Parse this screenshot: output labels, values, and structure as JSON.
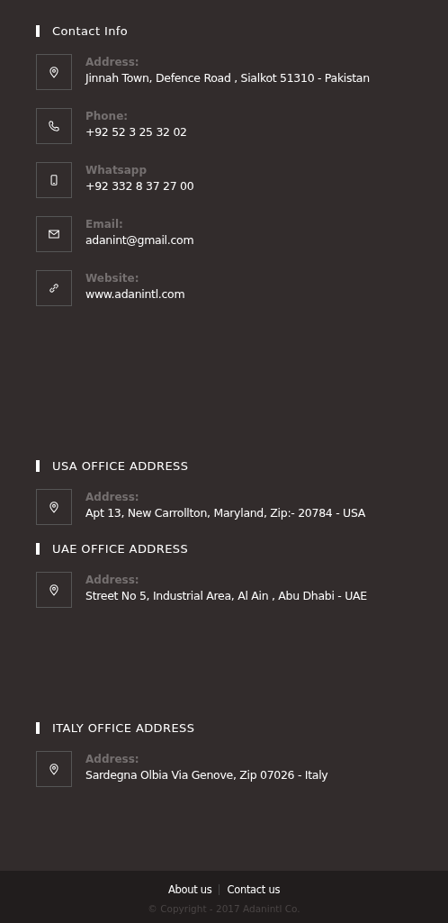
{
  "sections": [
    {
      "title": "Contact Info",
      "items": [
        {
          "kind": "address",
          "label": "Address:",
          "value": "Jinnah Town, Defence Road , Sialkot 51310 - Pakistan"
        },
        {
          "kind": "phone",
          "label": "Phone:",
          "value": "+92 52 3 25 32 02"
        },
        {
          "kind": "mobile",
          "label": "Whatsapp",
          "value": "+92 332 8 37 27 00"
        },
        {
          "kind": "email",
          "label": "Email:",
          "value": "adanint@gmail.com"
        },
        {
          "kind": "website",
          "label": "Website:",
          "value": "www.adanintl.com"
        }
      ]
    },
    {
      "title": "USA OFFICE ADDRESS",
      "items": [
        {
          "kind": "address",
          "label": "Address:",
          "value": "Apt 13, New Carrollton, Maryland, Zip:- 20784 - USA"
        }
      ]
    },
    {
      "title": "UAE OFFICE ADDRESS",
      "items": [
        {
          "kind": "address",
          "label": "Address:",
          "value": "Street No 5, Industrial Area, Al Ain , Abu Dhabi - UAE"
        }
      ]
    },
    {
      "title": "ITALY OFFICE ADDRESS",
      "items": [
        {
          "kind": "address",
          "label": "Address:",
          "value": "Sardegna Olbia Via Genove, Zip 07026 - Italy"
        }
      ]
    }
  ],
  "footer": {
    "links": [
      "About us",
      "Contact us"
    ],
    "copyright": "© Copyright - 2017 Adanintl Co."
  }
}
